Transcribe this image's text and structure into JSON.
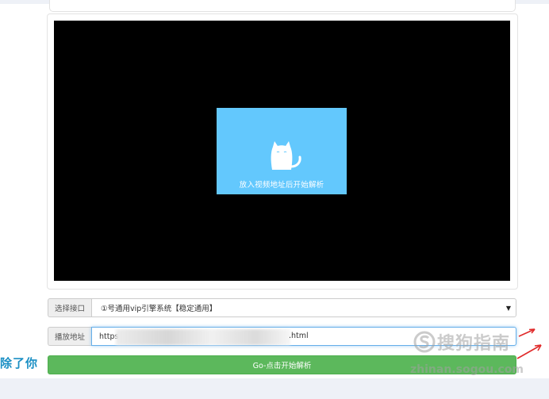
{
  "player": {
    "placeholder_text": "放入视频地址后开始解析",
    "icon": "cat-icon"
  },
  "interface_select": {
    "label": "选择接口",
    "selected": "①号通用vip引擎系统【稳定通用】"
  },
  "address_input": {
    "label": "播放地址",
    "value_prefix": "https",
    "value_suffix": ".html"
  },
  "go_button": {
    "label": "Go-点击开始解析"
  },
  "side_text": "除了你",
  "watermark": {
    "logo_text": "搜狗指南",
    "url": "zhinan.sogou.com"
  },
  "colors": {
    "placeholder_bg": "#63c8fd",
    "button_green": "#5cb85c",
    "arrow_red": "#e02a2a"
  }
}
